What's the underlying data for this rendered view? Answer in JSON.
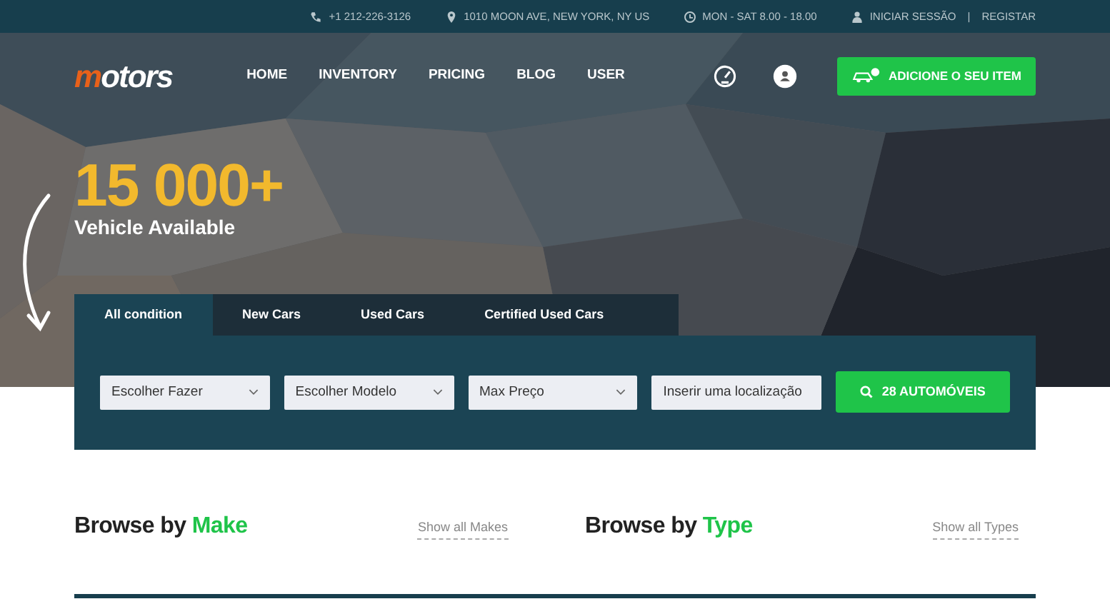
{
  "top_bar": {
    "phone": "+1 212-226-3126",
    "address": "1010 MOON AVE, NEW YORK, NY US",
    "hours": "MON - SAT 8.00 - 18.00",
    "login": "INICIAR SESSÃO",
    "separator": "|",
    "register": "REGISTAR"
  },
  "navbar": {
    "logo_first": "m",
    "logo_rest": "otors",
    "links": [
      {
        "label": "HOME"
      },
      {
        "label": "INVENTORY"
      },
      {
        "label": "PRICING"
      },
      {
        "label": "BLOG"
      },
      {
        "label": "USER"
      }
    ],
    "add_button": "ADICIONE O SEU ITEM"
  },
  "hero": {
    "count": "15 000+",
    "subtitle": "Vehicle Available"
  },
  "search": {
    "tabs": [
      {
        "label": "All condition",
        "selected": true
      },
      {
        "label": "New Cars",
        "selected": false
      },
      {
        "label": "Used Cars",
        "selected": false
      },
      {
        "label": "Certified Used Cars",
        "selected": false
      }
    ],
    "fields": [
      {
        "kind": "select",
        "value": "Escolher Fazer"
      },
      {
        "kind": "select",
        "value": "Escolher Modelo"
      },
      {
        "kind": "select",
        "value": "Max Preço"
      },
      {
        "kind": "input",
        "placeholder": "Inserir uma localização"
      }
    ],
    "button": "28 AUTOMÓVEIS"
  },
  "sections": [
    {
      "title": "Browse by",
      "highlight": "Make",
      "link": "Show all Makes"
    },
    {
      "title": "Browse by",
      "highlight": "Type",
      "link": "Show all Types"
    }
  ]
}
